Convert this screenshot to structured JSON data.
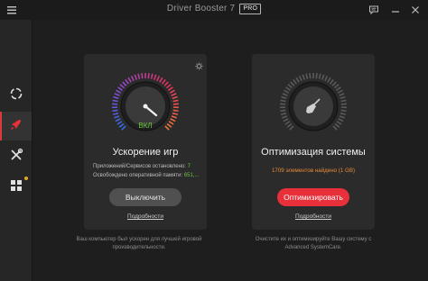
{
  "window": {
    "title": "Driver Booster 7",
    "badge": "PRO"
  },
  "boost": {
    "status": "ВКЛ",
    "title": "Ускорение игр",
    "stat1_label": "Приложений/Сервисов остановлено:",
    "stat1_value": "7",
    "stat2_label": "Освобождено оперативной памяти:",
    "stat2_value": "651,...",
    "button": "Выключить",
    "link": "Подробности",
    "note": "Ваш компьютер был ускорен для лучшей игровой производительности."
  },
  "optimize": {
    "title": "Оптимизация системы",
    "found": "1709 элементов найдено (1 GB)",
    "button": "Оптимизировать",
    "link": "Подробности",
    "note": "Очистите их и оптимизируйте Вашу систему с Advanced SystemCare."
  },
  "colors": {
    "accent_red": "#e8303a",
    "status_green": "#6ec23c",
    "found_orange": "#e98a35",
    "notify_dot": "#e5a620"
  },
  "icons": {
    "menu": "hamburger-icon",
    "feedback": "message-icon",
    "minimize": "minimize-icon",
    "close": "close-icon",
    "sidebar": [
      "refresh-icon",
      "rocket-icon",
      "tools-icon",
      "apps-icon"
    ],
    "settings": "gear-icon",
    "broom": "broom-icon"
  }
}
